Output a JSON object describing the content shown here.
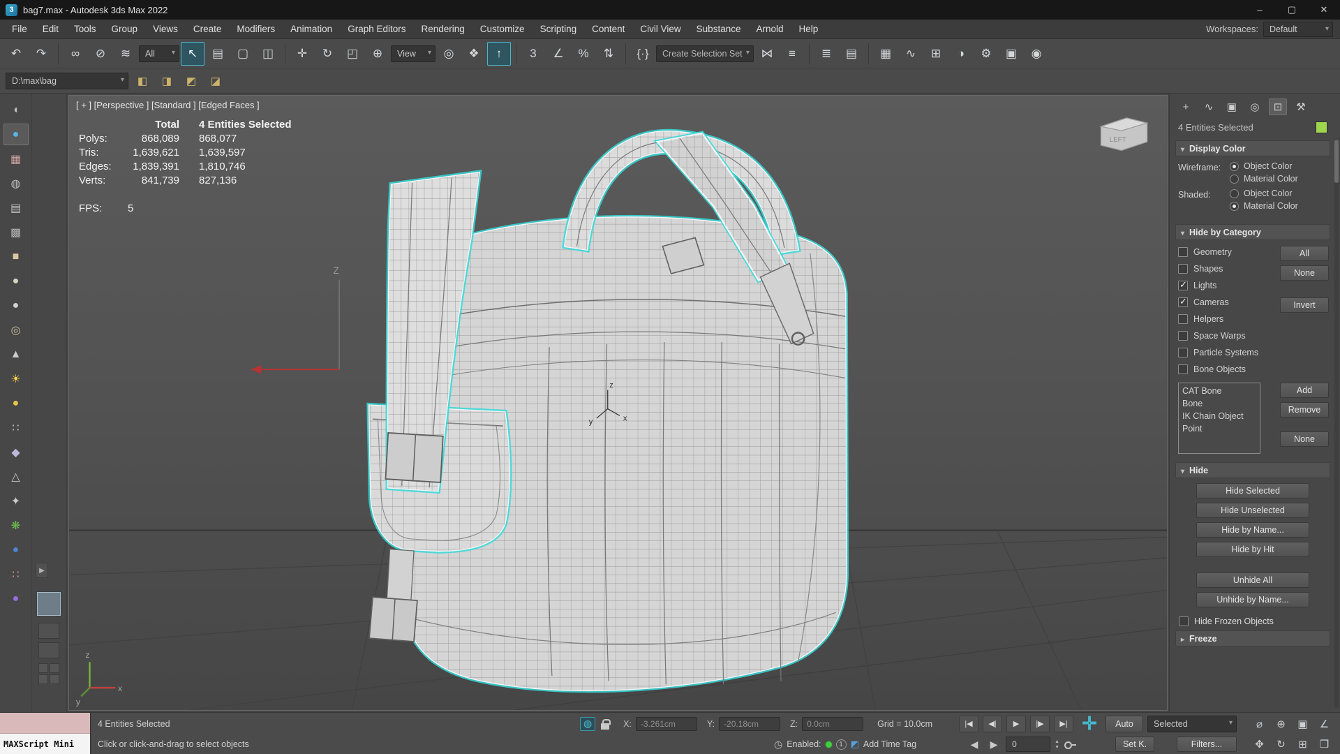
{
  "title_bar": {
    "app_icon_glyph": "3",
    "title": "bag7.max - Autodesk 3ds Max 2022",
    "minimize_glyph": "–",
    "maximize_glyph": "▢",
    "close_glyph": "✕"
  },
  "menu_bar": {
    "items": [
      "File",
      "Edit",
      "Tools",
      "Group",
      "Views",
      "Create",
      "Modifiers",
      "Animation",
      "Graph Editors",
      "Rendering",
      "Customize",
      "Scripting",
      "Content",
      "Civil View",
      "Substance",
      "Arnold",
      "Help"
    ],
    "workspaces_label": "Workspaces:",
    "workspaces_value": "Default"
  },
  "toolbar_main": {
    "filter_value": "All",
    "coord_value": "View",
    "selection_set_placeholder": "Create Selection Set",
    "icons": [
      {
        "name": "undo-icon",
        "glyph": "↶"
      },
      {
        "name": "redo-icon",
        "glyph": "↷"
      },
      {
        "name": "select-and-link-icon",
        "glyph": "∞"
      },
      {
        "name": "unlink-selection-icon",
        "glyph": "⊘"
      },
      {
        "name": "bind-to-space-warp-icon",
        "glyph": "≋"
      },
      {
        "name": "select-object-icon",
        "glyph": "↖",
        "active": true
      },
      {
        "name": "select-by-name-icon",
        "glyph": "▤"
      },
      {
        "name": "rectangular-selection-region-icon",
        "glyph": "▢"
      },
      {
        "name": "window-crossing-icon",
        "glyph": "◫"
      },
      {
        "name": "select-and-move-icon",
        "glyph": "✛"
      },
      {
        "name": "select-and-rotate-icon",
        "glyph": "↻"
      },
      {
        "name": "select-and-scale-icon",
        "glyph": "◰"
      },
      {
        "name": "select-and-place-icon",
        "glyph": "⊕"
      },
      {
        "name": "use-pivot-point-center-icon",
        "glyph": "◎"
      },
      {
        "name": "select-and-manipulate-icon",
        "glyph": "❖"
      },
      {
        "name": "keyboard-shortcut-override-icon",
        "glyph": "↑",
        "active": true
      },
      {
        "name": "snaps-toggle-icon",
        "glyph": "3"
      },
      {
        "name": "angle-snap-icon",
        "glyph": "∠"
      },
      {
        "name": "percent-snap-icon",
        "glyph": "%"
      },
      {
        "name": "spinner-snap-icon",
        "glyph": "⇅"
      },
      {
        "name": "edit-named-selection-sets-icon",
        "glyph": "{·}"
      },
      {
        "name": "mirror-icon",
        "glyph": "⋈"
      },
      {
        "name": "align-icon",
        "glyph": "≡"
      },
      {
        "name": "toggle-scene-explorer-icon",
        "glyph": "≣"
      },
      {
        "name": "toggle-layer-explorer-icon",
        "glyph": "▤"
      },
      {
        "name": "open-ribbon-icon",
        "glyph": "▦"
      },
      {
        "name": "curve-editor-icon",
        "glyph": "∿"
      },
      {
        "name": "schematic-view-icon",
        "glyph": "⊞"
      },
      {
        "name": "material-editor-icon",
        "glyph": "◑"
      },
      {
        "name": "render-setup-icon",
        "glyph": "⚙"
      },
      {
        "name": "rendered-frame-window-icon",
        "glyph": "▣"
      },
      {
        "name": "render-production-icon",
        "glyph": "◉"
      }
    ]
  },
  "toolbar_path": {
    "path_value": "D:\\max\\bag",
    "icons": [
      {
        "name": "set-project-folder-icon",
        "glyph": "◧"
      },
      {
        "name": "asset-library-icon",
        "glyph": "◨"
      },
      {
        "name": "import-file-icon",
        "glyph": "◩"
      },
      {
        "name": "file-link-icon",
        "glyph": "◪"
      }
    ]
  },
  "left_toolbar": {
    "icons": [
      {
        "name": "hemisphere-tool-icon",
        "glyph": "◖",
        "color": "#bcbcbc"
      },
      {
        "name": "sphere-blue-tool-icon",
        "glyph": "●",
        "color": "#58b6e8",
        "selected": true
      },
      {
        "name": "image-plane-tool-icon",
        "glyph": "▦",
        "color": "#c9a2a2"
      },
      {
        "name": "capsule-tool-icon",
        "glyph": "◍",
        "color": "#c0c0c0"
      },
      {
        "name": "plane-tool-icon",
        "glyph": "▤",
        "color": "#c0c0c0"
      },
      {
        "name": "lattice-tool-icon",
        "glyph": "▩",
        "color": "#b5b5b5"
      },
      {
        "name": "box-tool-icon",
        "glyph": "■",
        "color": "#d9c9a0"
      },
      {
        "name": "blob-tool-icon",
        "glyph": "●",
        "color": "#d9d2c2"
      },
      {
        "name": "sphere-tool-icon",
        "glyph": "●",
        "color": "#d2d2d2"
      },
      {
        "name": "torus-tool-icon",
        "glyph": "◎",
        "color": "#c7bf96"
      },
      {
        "name": "cone-tool-icon",
        "glyph": "▲",
        "color": "#cccccc"
      },
      {
        "name": "light-tool-icon",
        "glyph": "☀",
        "color": "#ffd24a"
      },
      {
        "name": "sun-sphere-tool-icon",
        "glyph": "●",
        "color": "#e5c54b"
      },
      {
        "name": "particles-tool-icon",
        "glyph": "∷",
        "color": "#c4c4c4"
      },
      {
        "name": "paint-tool-icon",
        "glyph": "◆",
        "color": "#b9b9d9"
      },
      {
        "name": "pyramid-tool-icon",
        "glyph": "△",
        "color": "#c6c6c6"
      },
      {
        "name": "star-helper-tool-icon",
        "glyph": "✦",
        "color": "#cccccc"
      },
      {
        "name": "foliage-tool-icon",
        "glyph": "❋",
        "color": "#6fbf4d"
      },
      {
        "name": "sphere-dark-blue-tool-icon",
        "glyph": "●",
        "color": "#4f82d6"
      },
      {
        "name": "scatter-tool-icon",
        "glyph": "∷",
        "color": "#d79090"
      },
      {
        "name": "sphere-purple-tool-icon",
        "glyph": "●",
        "color": "#9a6ce0"
      }
    ]
  },
  "viewport": {
    "label_text": "[ + ] [Perspective ] [Standard ] [Edged Faces ]",
    "stats": {
      "col_total": "Total",
      "col_selected": "4 Entities Selected",
      "rows": [
        {
          "label": "Polys:",
          "total": "868,089",
          "selected": "868,077"
        },
        {
          "label": "Tris:",
          "total": "1,639,621",
          "selected": "1,639,597"
        },
        {
          "label": "Edges:",
          "total": "1,839,391",
          "selected": "1,810,746"
        },
        {
          "label": "Verts:",
          "total": "841,739",
          "selected": "827,136"
        }
      ],
      "fps_label": "FPS:",
      "fps_value": "5"
    },
    "axis_z_label": "Z",
    "viewcube_face": "LEFT",
    "mini_axis": {
      "x": "x",
      "y": "y",
      "z": "z"
    },
    "tripod": {
      "x": "x",
      "y": "y",
      "z": "z"
    },
    "selection_color": "#35d8d8"
  },
  "command_panel": {
    "tabs": [
      {
        "name": "create-tab",
        "glyph": "+"
      },
      {
        "name": "modify-tab",
        "glyph": "∿"
      },
      {
        "name": "hierarchy-tab",
        "glyph": "▣"
      },
      {
        "name": "motion-tab",
        "glyph": "◎"
      },
      {
        "name": "display-tab",
        "glyph": "⊡",
        "active": true
      },
      {
        "name": "utilities-tab",
        "glyph": "⚒"
      }
    ],
    "selection_label": "4 Entities Selected",
    "object_color": "#9ed54f",
    "display_color": {
      "title": "Display Color",
      "wireframe_label": "Wireframe:",
      "shaded_label": "Shaded:",
      "object_color_label": "Object Color",
      "material_color_label": "Material Color",
      "wireframe_object_selected": true,
      "wireframe_material_selected": false,
      "shaded_object_selected": false,
      "shaded_material_selected": true
    },
    "hide_by_category": {
      "title": "Hide by Category",
      "categories": [
        {
          "label": "Geometry",
          "checked": false
        },
        {
          "label": "Shapes",
          "checked": false
        },
        {
          "label": "Lights",
          "checked": true
        },
        {
          "label": "Cameras",
          "checked": true
        },
        {
          "label": "Helpers",
          "checked": false
        },
        {
          "label": "Space Warps",
          "checked": false
        },
        {
          "label": "Particle Systems",
          "checked": false
        },
        {
          "label": "Bone Objects",
          "checked": false
        }
      ],
      "all_button": "All",
      "none_button": "None",
      "invert_button": "Invert",
      "list_items": [
        "CAT Bone",
        "Bone",
        "IK Chain Object",
        "Point"
      ],
      "add_button": "Add",
      "remove_button": "Remove",
      "list_none_button": "None"
    },
    "hide": {
      "title": "Hide",
      "buttons": [
        "Hide Selected",
        "Hide Unselected",
        "Hide by Name...",
        "Hide by Hit"
      ],
      "buttons2": [
        "Unhide All",
        "Unhide by Name..."
      ],
      "frozen_checkbox_label": "Hide Frozen Objects",
      "frozen_checked": false
    },
    "freeze": {
      "title": "Freeze"
    }
  },
  "status_bar": {
    "maxscript_label": "MAXScript Mini",
    "selection_status": "4 Entities Selected",
    "prompt": "Click or click-and-drag to select objects",
    "isolate_glyph": "◍",
    "x_label": "X:",
    "x_value": "-3.261cm",
    "y_label": "Y:",
    "y_value": "-20.18cm",
    "z_label": "Z:",
    "z_value": "0.0cm",
    "grid_label": "Grid = 10.0cm",
    "scene_scripts_glyph": "◷",
    "enabled_label": "Enabled:",
    "enabled_count": "1",
    "time_tag_glyph": "◩",
    "add_time_tag": "Add Time Tag",
    "frame_prev_glyph": "◀",
    "frame_next_glyph": "▶",
    "frame_value": "0",
    "set_key_plus_glyph": "✛",
    "auto_button": "Auto",
    "selected_dropdown": "Selected",
    "set_key_button": "Set K.",
    "filters_button": "Filters...",
    "playback": [
      {
        "name": "go-to-start-button",
        "glyph": "|◀"
      },
      {
        "name": "previous-frame-button",
        "glyph": "◀|"
      },
      {
        "name": "play-button",
        "glyph": "▶"
      },
      {
        "name": "next-frame-button",
        "glyph": "|▶"
      },
      {
        "name": "go-to-end-button",
        "glyph": "▶|"
      }
    ],
    "nav_row1": [
      {
        "name": "zoom-icon",
        "glyph": "⌀"
      },
      {
        "name": "zoom-all-icon",
        "glyph": "⊕"
      },
      {
        "name": "zoom-extents-icon",
        "glyph": "▣"
      },
      {
        "name": "field-of-view-icon",
        "glyph": "∠"
      }
    ],
    "nav_row2": [
      {
        "name": "pan-icon",
        "glyph": "✥"
      },
      {
        "name": "orbit-icon",
        "glyph": "↻"
      },
      {
        "name": "zoom-region-icon",
        "glyph": "⊞"
      },
      {
        "name": "maximize-viewport-icon",
        "glyph": "❒"
      }
    ]
  }
}
